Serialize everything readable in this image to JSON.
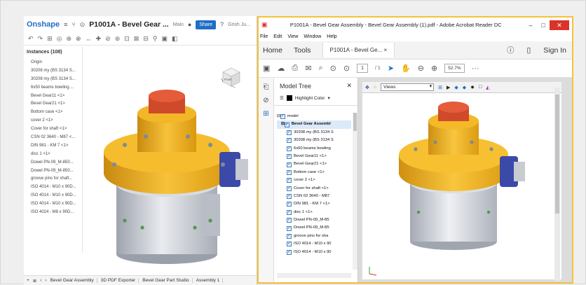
{
  "onshape": {
    "logo": "Onshape",
    "title": "P1001A - Bevel Gear ...",
    "branch": "Main",
    "share_label": "Share",
    "user": "Grish Ju...",
    "instances_title": "Instances (108)",
    "instances": [
      "Origin",
      "30208 my (BS 3134 S...",
      "30208 my (BS 3134 S...",
      "6x50 beams bowling ...",
      "Bevel Gear11 <1>",
      "Bevel Gear21 <1>",
      "Bottom case <1>",
      "cover 2 <1>",
      "Cover for shaft <1>",
      "CSN 02 3640 - M87 <...",
      "DIN 981 - KM 7 <1>",
      "disc 1 <1>",
      "Dowel PN-09_M-850...",
      "Dowel PN-09_M-850...",
      "groove pins for shaft...",
      "ISO 4014 - M10 x 90D...",
      "ISO 4014 - M10 x 90D...",
      "ISO 4014 - M10 x 90D...",
      "ISO 4024 - M8 x 90D..."
    ],
    "tabs": [
      "Bevel Gear Assembly",
      "3D PDF Exporter",
      "Bevel Gear Part Studio",
      "Assembly 1"
    ],
    "cube_label": "Front"
  },
  "acrobat": {
    "window_title": "P1001A - Bevel Gear Assembly - Bevel Gear Assembly (1).pdf - Adobe Acrobat Reader DC",
    "menu": [
      "File",
      "Edit",
      "View",
      "Window",
      "Help"
    ],
    "home_tab": "Home",
    "tools_tab": "Tools",
    "doc_tab": "P1001A - Bevel Ge...",
    "sign_in": "Sign In",
    "page_current": "1",
    "page_total": "/ 1",
    "zoom": "52.7%",
    "panel_title": "Model Tree",
    "highlight_label": "Highlight Color",
    "views_label": "Views",
    "tree_root": "model",
    "tree_items": [
      "Bevel Gear Assembl",
      "30208 my (BS 3134 S",
      "30208 my (BS 3134 S",
      "6x50 beams bowling",
      "Bevel Gear11 <1>",
      "Bevel Gear21 <1>",
      "Bottom case <1>",
      "cover 2 <1>",
      "Cover for shaft <1>",
      "CSN 02 3640 - M87",
      "DIN 981 - KM 7 <1>",
      "disc 1 <1>",
      "Dowel PN-09_M-85",
      "Dowel PN-09_M-85",
      "groove pins for sha",
      "ISO 4014 - M10 x 90",
      "ISO 4014 - M10 x 90"
    ]
  },
  "colors": {
    "onshape_blue": "#1f6fc5",
    "gear_yellow": "#f0b31c",
    "gear_red": "#d94a2a",
    "case_gray": "#c9ccd3",
    "acrobat_border": "#f5c338",
    "close_red": "#d9342b"
  }
}
